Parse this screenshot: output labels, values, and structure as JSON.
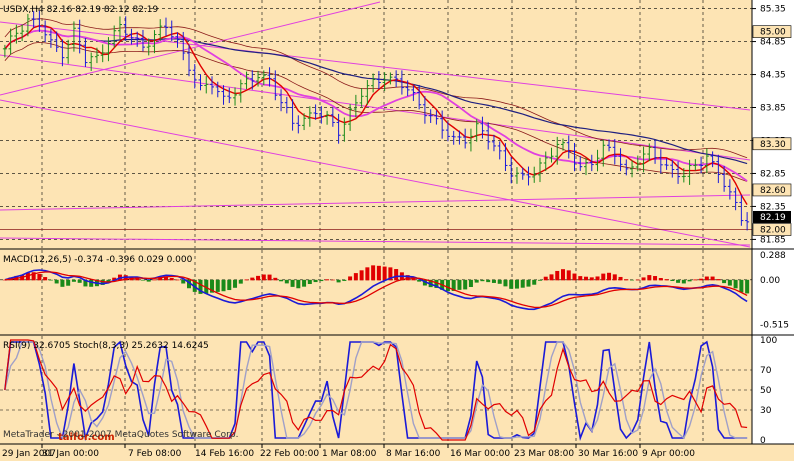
{
  "colors": {
    "background": "#fde4b4",
    "axis_panel": "#ffffff",
    "grid": "#000000",
    "bull": "#1a8a1a",
    "bear": "#1a1ad8",
    "magenta": "#e040e0",
    "red": "#e00000",
    "navy": "#202080",
    "brown": "#8b1a1a",
    "label_bg": "#fde4b4"
  },
  "main_panel": {
    "header": "USDX,H4  82.16 82.19 82.12 82.19",
    "price_labels": [
      "85.35",
      "84.85",
      "84.35",
      "83.85",
      "83.35",
      "82.85",
      "82.35",
      "81.85"
    ],
    "boxed_levels": [
      "85.00",
      "83.30",
      "82.60",
      "82.00"
    ],
    "current_price": "82.19"
  },
  "macd_panel": {
    "header": "MACD(12,26,5) -0.374 -0.396 0.029 0.000",
    "scale_labels": [
      "0.288",
      "0.00",
      "-0.515"
    ]
  },
  "rsi_panel": {
    "header": "RSI(9) 32.6705   Stoch(8,3,3) 25.2632 14.6245",
    "scale_labels": [
      "100",
      "70",
      "50",
      "30",
      "0"
    ]
  },
  "time_axis": {
    "labels": [
      "29 Jan 2007",
      "31 Jan 00:00",
      "7 Feb 08:00",
      "14 Feb 16:00",
      "22 Feb 00:00",
      "1 Mar 08:00",
      "8 Mar 16:00",
      "16 Mar 00:00",
      "23 Mar 08:00",
      "30 Mar 16:00",
      "9 Apr 00:00"
    ]
  },
  "watermark": {
    "brand": "MetaTrader - 2001-2007 MetaQuotes Software Corp.",
    "site": "taifor.com"
  },
  "chart_data": [
    {
      "type": "candlestick",
      "title": "USDX,H4",
      "ylim": [
        81.75,
        85.45
      ],
      "close_waypoints": [
        [
          0,
          84.7
        ],
        [
          2,
          85.0
        ],
        [
          4,
          85.2
        ],
        [
          6,
          85.1
        ],
        [
          8,
          84.8
        ],
        [
          10,
          84.7
        ],
        [
          12,
          85.0
        ],
        [
          14,
          84.55
        ],
        [
          16,
          84.6
        ],
        [
          18,
          84.9
        ],
        [
          20,
          85.05
        ],
        [
          22,
          84.9
        ],
        [
          24,
          84.8
        ],
        [
          26,
          84.95
        ],
        [
          28,
          85.05
        ],
        [
          30,
          84.85
        ],
        [
          32,
          84.5
        ],
        [
          34,
          84.1
        ],
        [
          36,
          84.2
        ],
        [
          38,
          84.0
        ],
        [
          40,
          84.1
        ],
        [
          42,
          84.2
        ],
        [
          44,
          84.35
        ],
        [
          46,
          84.3
        ],
        [
          48,
          83.9
        ],
        [
          50,
          83.6
        ],
        [
          52,
          83.7
        ],
        [
          54,
          83.8
        ],
        [
          56,
          83.65
        ],
        [
          58,
          83.5
        ],
        [
          60,
          83.8
        ],
        [
          62,
          84.05
        ],
        [
          64,
          84.2
        ],
        [
          66,
          84.35
        ],
        [
          68,
          84.25
        ],
        [
          70,
          84.1
        ],
        [
          72,
          83.9
        ],
        [
          74,
          83.75
        ],
        [
          76,
          83.5
        ],
        [
          78,
          83.35
        ],
        [
          80,
          83.4
        ],
        [
          82,
          83.55
        ],
        [
          84,
          83.35
        ],
        [
          86,
          83.15
        ],
        [
          88,
          82.9
        ],
        [
          90,
          82.75
        ],
        [
          92,
          82.85
        ],
        [
          94,
          83.1
        ],
        [
          96,
          83.3
        ],
        [
          98,
          83.15
        ],
        [
          100,
          82.95
        ],
        [
          102,
          83.05
        ],
        [
          104,
          83.2
        ],
        [
          106,
          83.15
        ],
        [
          108,
          82.9
        ],
        [
          110,
          83.05
        ],
        [
          112,
          83.15
        ],
        [
          114,
          83.05
        ],
        [
          116,
          82.9
        ],
        [
          118,
          82.8
        ],
        [
          120,
          82.95
        ],
        [
          122,
          83.15
        ],
        [
          124,
          82.85
        ],
        [
          126,
          82.5
        ],
        [
          128,
          82.2
        ],
        [
          129,
          82.19
        ]
      ],
      "indicators": [
        "moving averages",
        "envelope channel",
        "trend lines"
      ]
    },
    {
      "type": "bar",
      "title": "MACD(12,26,5)",
      "series": [
        {
          "name": "MACD",
          "value": -0.374
        },
        {
          "name": "Signal",
          "value": -0.396
        },
        {
          "name": "Histogram",
          "value": 0.029
        }
      ],
      "ylim": [
        -0.6,
        0.32
      ]
    },
    {
      "type": "line",
      "title": "RSI(9) / Stoch(8,3,3)",
      "series": [
        {
          "name": "RSI(9)",
          "last": 32.6705
        },
        {
          "name": "Stoch %K",
          "last": 25.2632
        },
        {
          "name": "Stoch %D",
          "last": 14.6245
        }
      ],
      "ylim": [
        0,
        100
      ]
    }
  ]
}
